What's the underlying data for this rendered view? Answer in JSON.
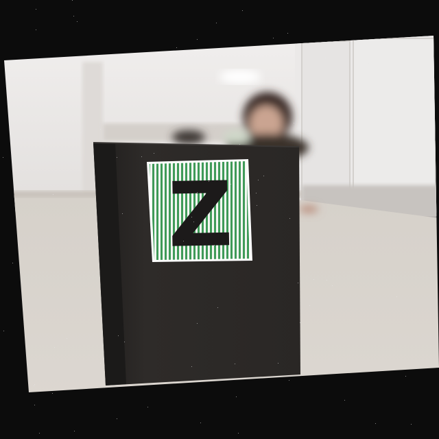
{
  "photo": {
    "sign_letter": "Z",
    "colors": {
      "border": "#0c0c0c",
      "wall": "#e9e7e5",
      "floor": "#d8d2cb",
      "box": "#2b2826",
      "stripe_green": "#3f9a58",
      "letter": "#1c1a1a"
    }
  }
}
